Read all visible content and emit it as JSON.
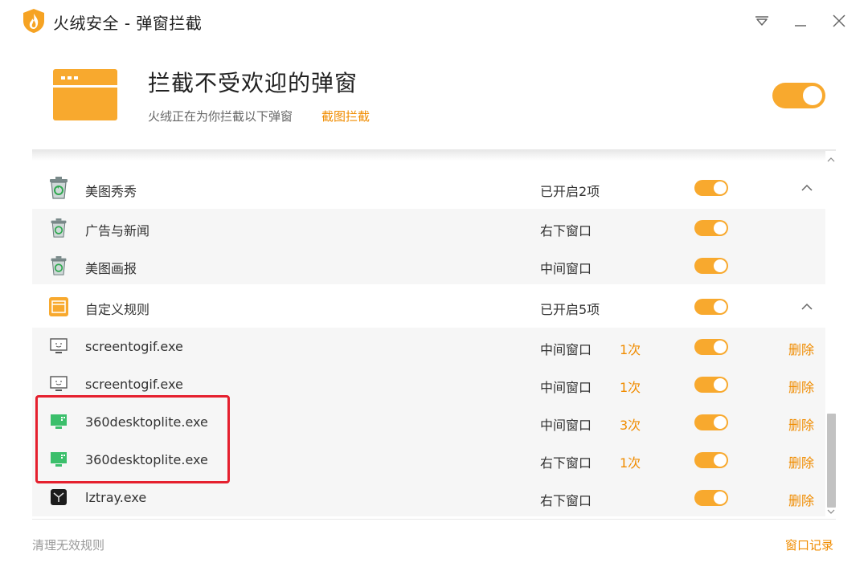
{
  "window": {
    "title": "火绒安全 - 弹窗拦截",
    "controls": [
      "menu",
      "minimize",
      "close"
    ]
  },
  "header": {
    "title": "拦截不受欢迎的弹窗",
    "subtitle": "火绒正在为你拦截以下弹窗",
    "link": "截图拦截",
    "master_toggle": "on"
  },
  "groups": [
    {
      "name": "美图秀秀",
      "status": "已开启2项",
      "icon": "recycle-bin-icon",
      "enabled": true,
      "expanded": true,
      "items": [
        {
          "name": "广告与新闻",
          "status": "右下窗口",
          "icon": "recycle-bin-icon",
          "enabled": true
        },
        {
          "name": "美图画报",
          "status": "中间窗口",
          "icon": "recycle-bin-icon",
          "enabled": true
        }
      ]
    },
    {
      "name": "自定义规则",
      "status": "已开启5项",
      "icon": "window-icon",
      "enabled": true,
      "expanded": true,
      "items": [
        {
          "name": "screentogif.exe",
          "status": "中间窗口",
          "count": "1次",
          "delete": "删除",
          "icon": "monitor-icon",
          "enabled": true
        },
        {
          "name": "screentogif.exe",
          "status": "中间窗口",
          "count": "1次",
          "delete": "删除",
          "icon": "monitor-icon",
          "enabled": true
        },
        {
          "name": "360desktoplite.exe",
          "status": "中间窗口",
          "count": "3次",
          "delete": "删除",
          "icon": "green-monitor-icon",
          "enabled": true
        },
        {
          "name": "360desktoplite.exe",
          "status": "右下窗口",
          "count": "1次",
          "delete": "删除",
          "icon": "green-monitor-icon",
          "enabled": true
        },
        {
          "name": "lztray.exe",
          "status": "右下窗口",
          "delete": "删除",
          "icon": "lztray-icon",
          "enabled": true
        }
      ]
    }
  ],
  "footer": {
    "left": "清理无效规则",
    "right": "窗口记录"
  },
  "colors": {
    "accent": "#f8a92e",
    "link": "#f08c00",
    "highlight": "#e5202e"
  }
}
